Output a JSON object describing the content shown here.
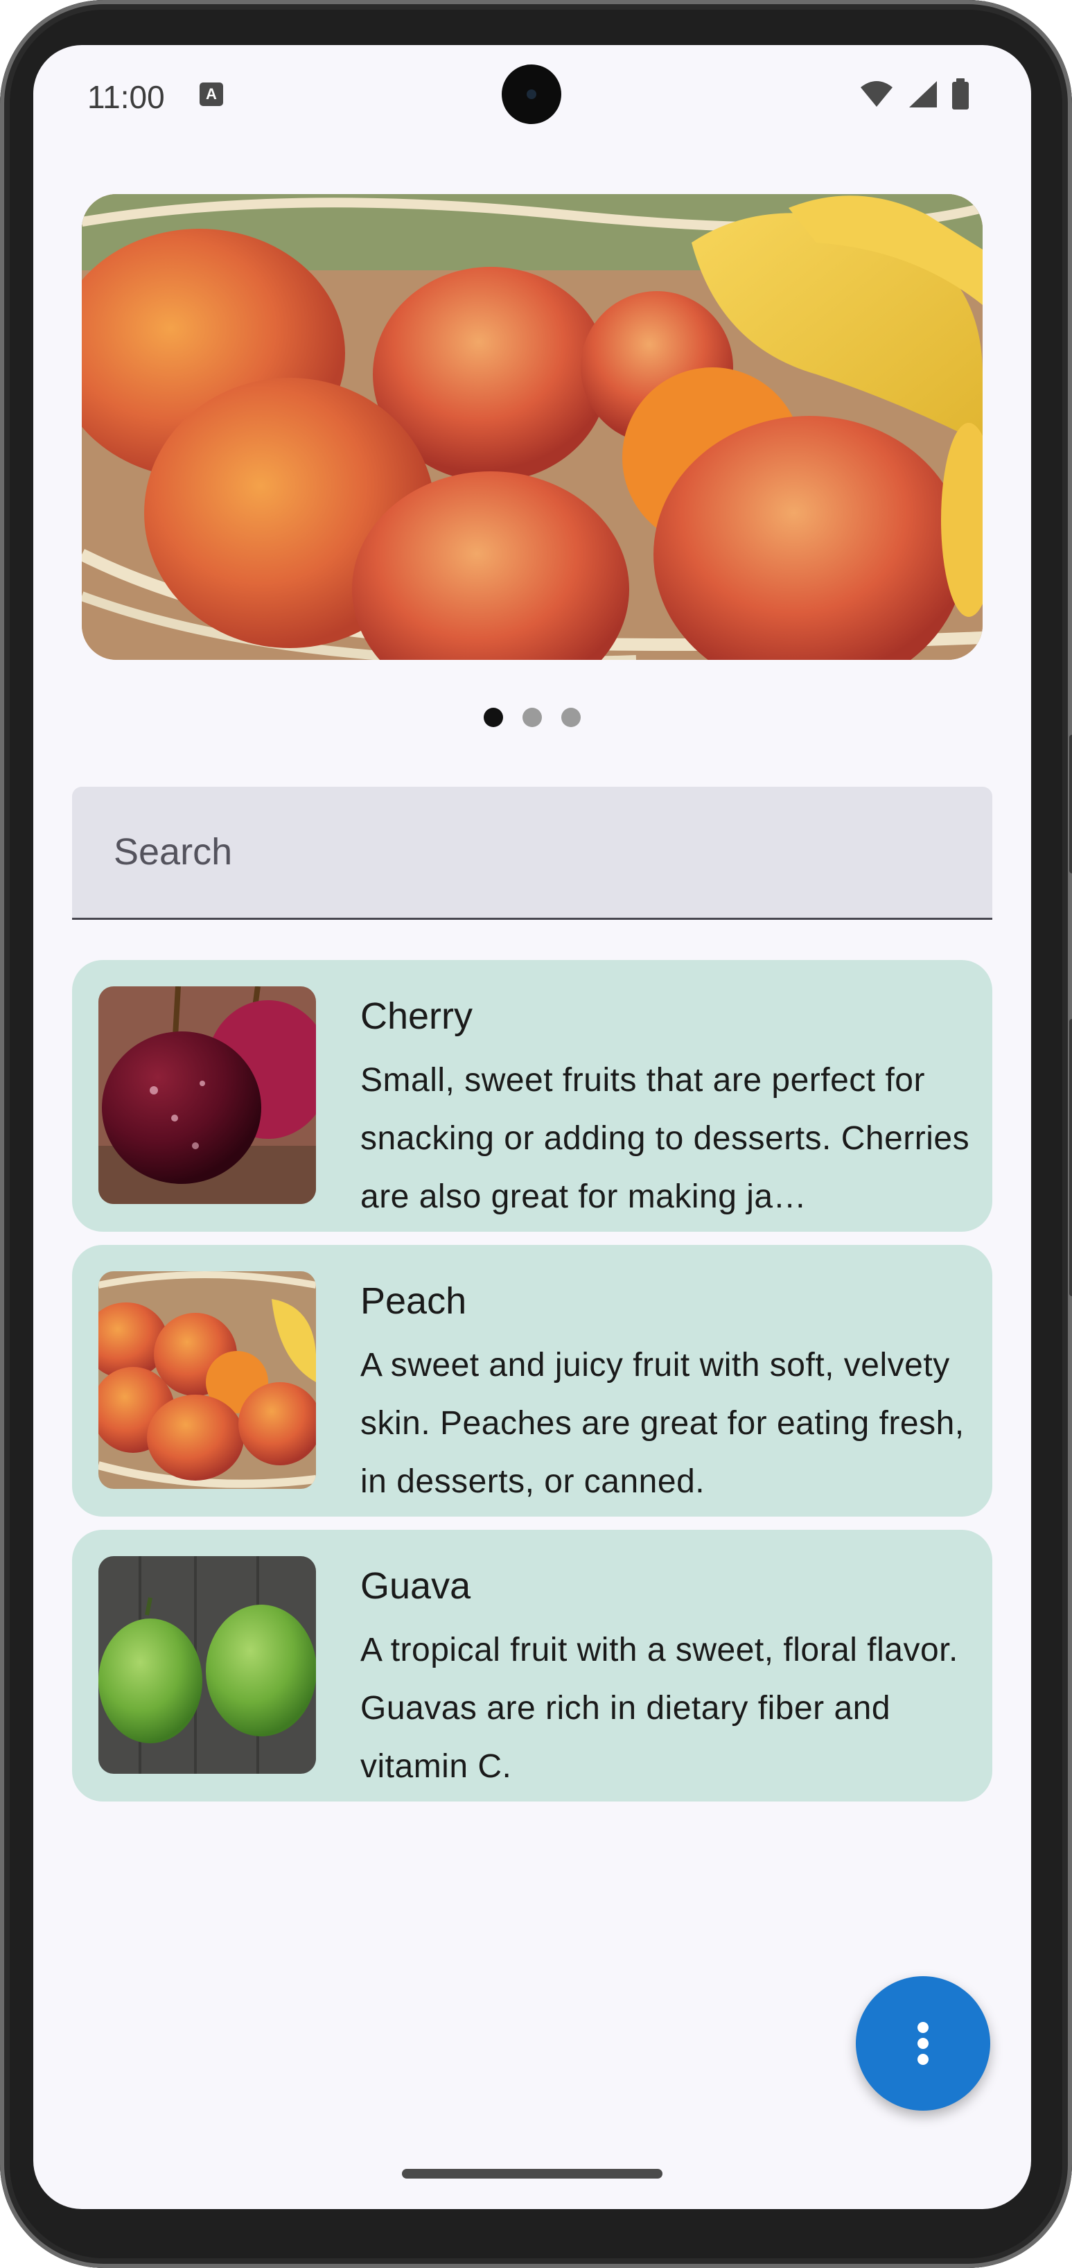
{
  "status_bar": {
    "time": "11:00",
    "indicator_letter": "A",
    "icons": [
      "text-input-indicator-icon",
      "wifi-icon",
      "cellular-signal-icon",
      "battery-icon"
    ]
  },
  "carousel": {
    "image": "peach-basket-photo",
    "page_count": 3,
    "active_page": 1
  },
  "search": {
    "placeholder": "Search",
    "value": ""
  },
  "fruits": [
    {
      "title": "Cherry",
      "image": "cherry-photo",
      "description": "Small, sweet fruits that are perfect for snacking or adding to desserts. Cherries are also great for making ja…"
    },
    {
      "title": "Peach",
      "image": "peach-photo",
      "description": "A sweet and juicy fruit with soft, velvety skin. Peaches are great for eating fresh, in desserts, or canned."
    },
    {
      "title": "Guava",
      "image": "guava-photo",
      "description": "A tropical fruit with a sweet, floral flavor. Guavas are rich in dietary fiber and vitamin C."
    }
  ],
  "fab": {
    "icon": "more-vert-icon"
  },
  "colors": {
    "background": "#f8f7fc",
    "card": "#cce5df",
    "search_field": "#e2e2ea",
    "fab": "#1a78cf"
  }
}
